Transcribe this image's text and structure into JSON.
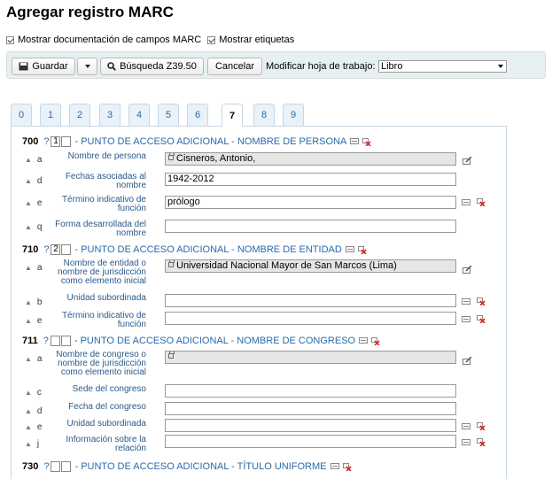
{
  "page": {
    "title": "Agregar registro MARC",
    "opt_doc": "Mostrar documentación de campos MARC",
    "opt_tags": "Mostrar etiquetas"
  },
  "toolbar": {
    "save": "Guardar",
    "search": "Búsqueda Z39.50",
    "cancel": "Cancelar",
    "sheet_label": "Modificar hoja de trabajo:",
    "sheet_value": "Libro"
  },
  "tabs": [
    "0",
    "1",
    "2",
    "3",
    "4",
    "5",
    "6",
    "7",
    "8",
    "9"
  ],
  "active_tab": "7",
  "fields": {
    "f700": {
      "tag": "700",
      "q": "?",
      "ind1": "1",
      "ind2": "",
      "name": "- PUNTO DE ACCESO ADICIONAL - NOMBRE DE PERSONA",
      "subs": [
        {
          "code": "a",
          "label": "Nombre de persona",
          "value": "Cisneros, Antonio,"
        },
        {
          "code": "d",
          "label": "Fechas asociadas al nombre",
          "value": "1942-2012"
        },
        {
          "code": "e",
          "label": "Término indicativo de función",
          "value": "prólogo"
        },
        {
          "code": "q",
          "label": "Forma desarrollada del nombre",
          "value": ""
        }
      ]
    },
    "f710": {
      "tag": "710",
      "q": "?",
      "ind1": "2",
      "ind2": "",
      "name": "- PUNTO DE ACCESO ADICIONAL - NOMBRE DE ENTIDAD",
      "subs": [
        {
          "code": "a",
          "label": "Nombre de entidad o nombre de jurisdicción como elemento inicial",
          "value": "Universidad Nacional Mayor de San Marcos (Lima)"
        },
        {
          "code": "b",
          "label": "Unidad subordinada",
          "value": ""
        },
        {
          "code": "e",
          "label": "Término indicativo de función",
          "value": ""
        }
      ]
    },
    "f711": {
      "tag": "711",
      "q": "?",
      "ind1": "",
      "ind2": "",
      "name": "- PUNTO DE ACCESO ADICIONAL - NOMBRE DE CONGRESO",
      "subs": [
        {
          "code": "a",
          "label": "Nombre de congreso o nombre de jurisdicción como elemento inicial",
          "value": ""
        },
        {
          "code": "c",
          "label": "Sede del congreso",
          "value": ""
        },
        {
          "code": "d",
          "label": "Fecha del congreso",
          "value": ""
        },
        {
          "code": "e",
          "label": "Unidad subordinada",
          "value": ""
        },
        {
          "code": "j",
          "label": "Información sobre la relación",
          "value": ""
        }
      ]
    },
    "f730": {
      "tag": "730",
      "q": "?",
      "ind1": "",
      "ind2": "",
      "name": "- PUNTO DE ACCESO ADICIONAL - TÍTULO UNIFORME"
    }
  },
  "colors": {
    "link": "#2a6aaa",
    "toolbar_bg": "#e6f0f2",
    "readonly_bg": "#e6e6e6"
  }
}
